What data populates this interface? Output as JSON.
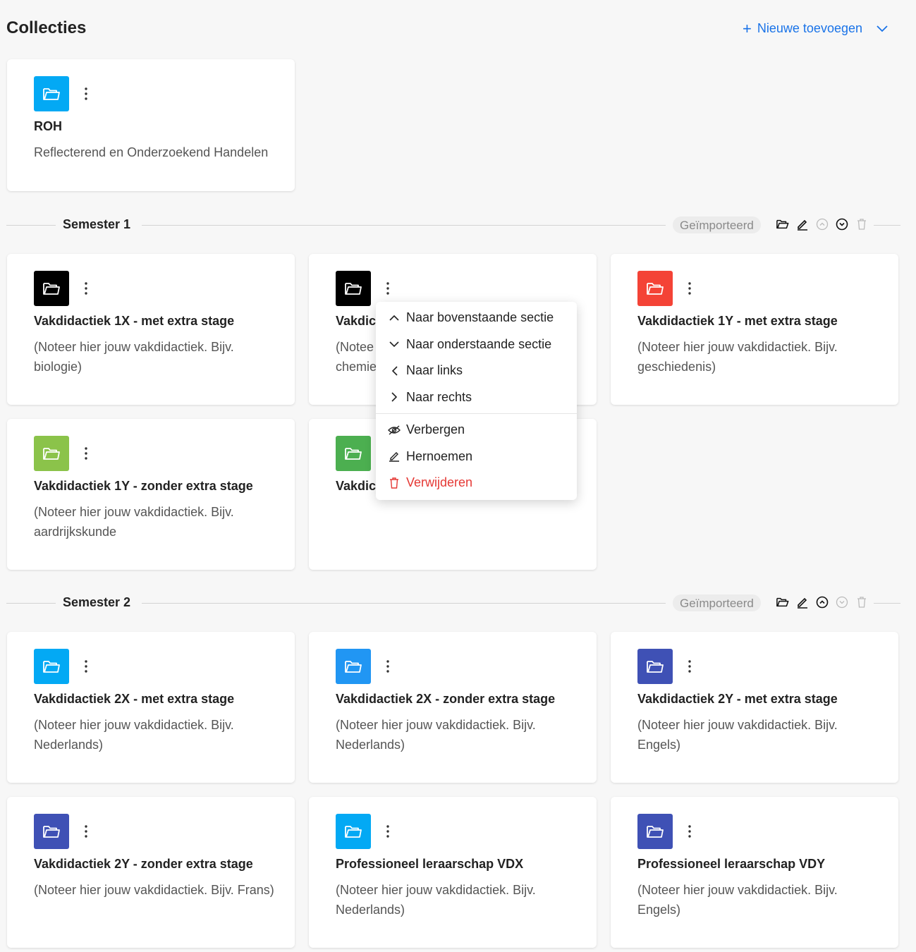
{
  "header": {
    "title": "Collecties",
    "add_new_label": "Nieuwe toevoegen"
  },
  "roh": {
    "title": "ROH",
    "description": "Reflecterend en Onderzoekend Handelen",
    "color": "#03a9f4"
  },
  "sections": [
    {
      "title": "Semester 1",
      "badge": "Geïmporteerd"
    },
    {
      "title": "Semester 2",
      "badge": "Geïmporteerd"
    }
  ],
  "semester1_cards": [
    {
      "title": "Vakdidactiek 1X - met extra stage",
      "description": "(Noteer hier jouw vakdidactiek. Bijv. biologie)",
      "color": "#000000"
    },
    {
      "title": "Vakdic",
      "description": "(Notee chemie",
      "color": "#000000"
    },
    {
      "title": "Vakdidactiek 1Y - met extra stage",
      "description": "(Noteer hier jouw vakdidactiek. Bijv. geschiedenis)",
      "color": "#f44336"
    },
    {
      "title": "Vakdidactiek 1Y - zonder extra stage",
      "description": "(Noteer hier jouw vakdidactiek. Bijv. aardrijkskunde",
      "color": "#8bc34a"
    },
    {
      "title": "Vakdic",
      "description": "",
      "color": "#4caf50"
    }
  ],
  "semester2_cards": [
    {
      "title": "Vakdidactiek 2X - met extra stage",
      "description": "(Noteer hier jouw vakdidactiek. Bijv. Nederlands)",
      "color": "#03a9f4"
    },
    {
      "title": "Vakdidactiek 2X - zonder extra stage",
      "description": "(Noteer hier jouw vakdidactiek. Bijv. Nederlands)",
      "color": "#2196f3"
    },
    {
      "title": "Vakdidactiek 2Y - met extra stage",
      "description": "(Noteer hier jouw vakdidactiek. Bijv. Engels)",
      "color": "#3f51b5"
    },
    {
      "title": "Vakdidactiek 2Y - zonder extra stage",
      "description": "(Noteer hier jouw vakdidactiek. Bijv. Frans)",
      "color": "#3f51b5"
    },
    {
      "title": "Professioneel leraarschap VDX",
      "description": "(Noteer hier jouw vakdidactiek. Bijv. Nederlands)",
      "color": "#03a9f4"
    },
    {
      "title": "Professioneel leraarschap VDY",
      "description": "(Noteer hier jouw vakdidactiek. Bijv. Engels)",
      "color": "#3f51b5"
    }
  ],
  "context_menu": {
    "items": [
      {
        "label": "Naar bovenstaande sectie",
        "icon": "chevron-up-icon"
      },
      {
        "label": "Naar onderstaande sectie",
        "icon": "chevron-down-icon"
      },
      {
        "label": "Naar links",
        "icon": "chevron-left-icon"
      },
      {
        "label": "Naar rechts",
        "icon": "chevron-right-icon"
      },
      {
        "label": "Verbergen",
        "icon": "eye-off-icon"
      },
      {
        "label": "Hernoemen",
        "icon": "pencil-icon"
      },
      {
        "label": "Verwijderen",
        "icon": "trash-icon",
        "color": "#e53935"
      }
    ]
  }
}
